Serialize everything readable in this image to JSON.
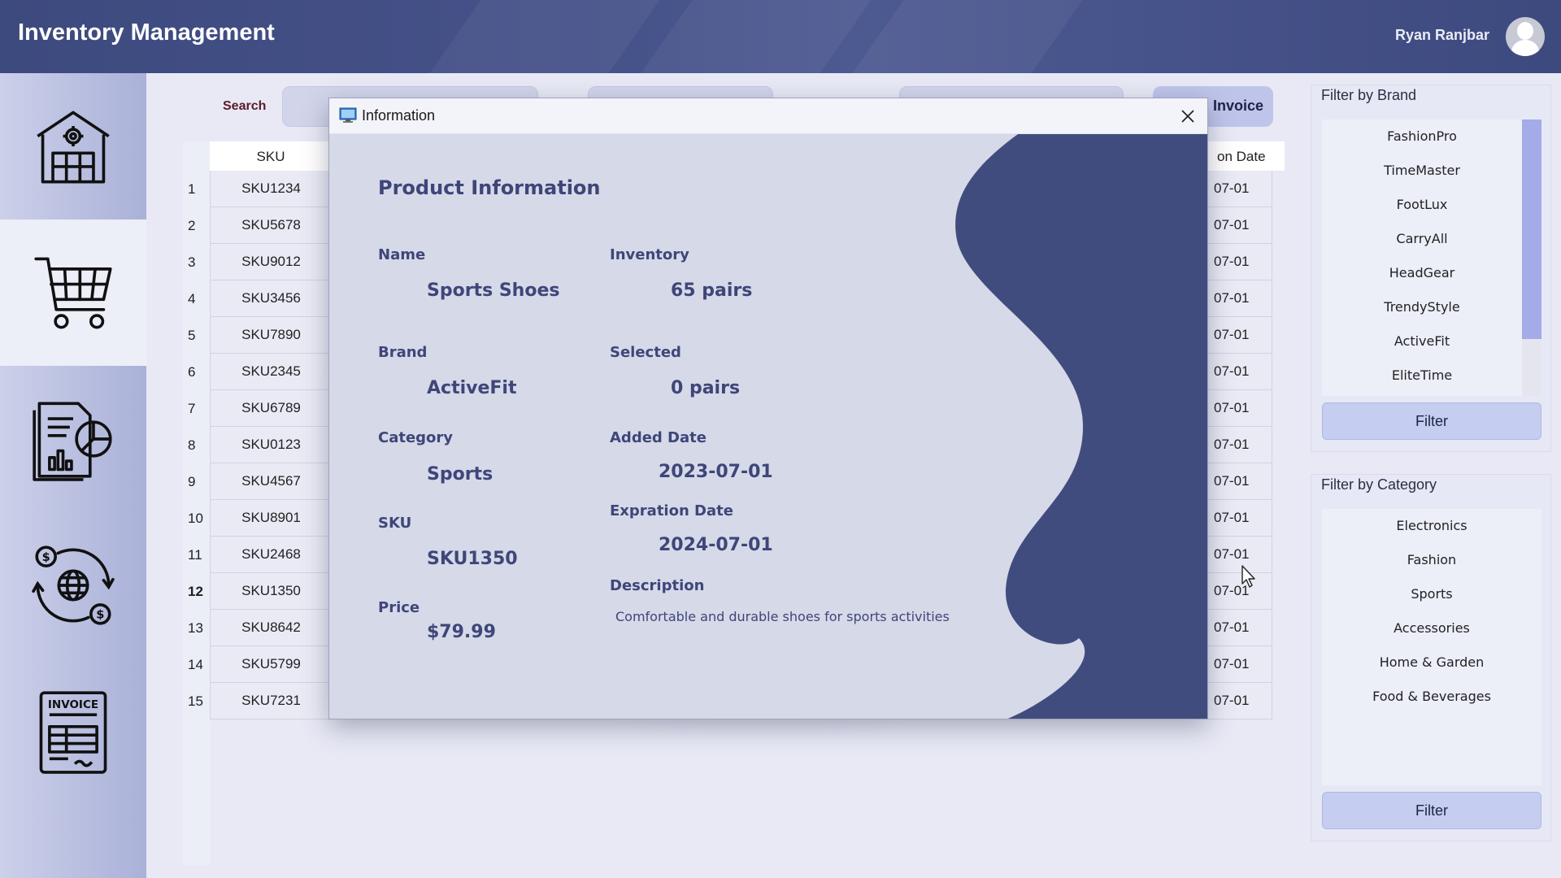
{
  "header": {
    "app_title": "Inventory Management",
    "user_name": "Ryan Ranjbar"
  },
  "sidebar": {
    "items": [
      {
        "name": "warehouse-icon",
        "active": false
      },
      {
        "name": "cart-icon",
        "active": true
      },
      {
        "name": "reports-icon",
        "active": false
      },
      {
        "name": "currency-exchange-icon",
        "active": false
      },
      {
        "name": "invoice-icon",
        "active": false
      }
    ]
  },
  "toolbar": {
    "search_label": "Search",
    "search_placeholder": "",
    "invoice_label": "Invoice"
  },
  "table": {
    "headers": {
      "sku": "SKU",
      "expiration_date": "on Date"
    },
    "rows": [
      {
        "num": "1",
        "sku": "SKU1234",
        "exp": "07-01"
      },
      {
        "num": "2",
        "sku": "SKU5678",
        "exp": "07-01"
      },
      {
        "num": "3",
        "sku": "SKU9012",
        "exp": "07-01"
      },
      {
        "num": "4",
        "sku": "SKU3456",
        "exp": "07-01"
      },
      {
        "num": "5",
        "sku": "SKU7890",
        "exp": "07-01"
      },
      {
        "num": "6",
        "sku": "SKU2345",
        "exp": "07-01"
      },
      {
        "num": "7",
        "sku": "SKU6789",
        "exp": "07-01"
      },
      {
        "num": "8",
        "sku": "SKU0123",
        "exp": "07-01"
      },
      {
        "num": "9",
        "sku": "SKU4567",
        "exp": "07-01"
      },
      {
        "num": "10",
        "sku": "SKU8901",
        "exp": "07-01"
      },
      {
        "num": "11",
        "sku": "SKU2468",
        "exp": "07-01"
      },
      {
        "num": "12",
        "sku": "SKU1350",
        "exp": "07-01"
      },
      {
        "num": "13",
        "sku": "SKU8642",
        "exp": "07-01"
      },
      {
        "num": "14",
        "sku": "SKU5799",
        "exp": "07-01"
      },
      {
        "num": "15",
        "sku": "SKU7231",
        "exp": "07-01"
      }
    ]
  },
  "filters": {
    "brand": {
      "title": "Filter by Brand",
      "items": [
        "FashionPro",
        "TimeMaster",
        "FootLux",
        "CarryAll",
        "HeadGear",
        "TrendyStyle",
        "ActiveFit",
        "EliteTime"
      ],
      "button_label": "Filter"
    },
    "category": {
      "title": "Filter by Category",
      "items": [
        "Electronics",
        "Fashion",
        "Sports",
        "Accessories",
        "Home & Garden",
        "Food & Beverages"
      ],
      "button_label": "Filter"
    }
  },
  "dialog": {
    "title": "Information",
    "heading": "Product Information",
    "fields": {
      "name_label": "Name",
      "name_value": "Sports Shoes",
      "brand_label": "Brand",
      "brand_value": "ActiveFit",
      "category_label": "Category",
      "category_value": "Sports",
      "sku_label": "SKU",
      "sku_value": "SKU1350",
      "price_label": "Price",
      "price_value": "$79.99",
      "inventory_label": "Inventory",
      "inventory_value": "65 pairs",
      "selected_label": "Selected",
      "selected_value": "0 pairs",
      "added_date_label": "Added Date",
      "added_date_value": "2023-07-01",
      "expiration_date_label": "Expration Date",
      "expiration_date_value": "2024-07-01",
      "description_label": "Description",
      "description_value": "Comfortable and durable shoes for sports activities"
    }
  },
  "colors": {
    "header_bg": "#3d4a7e",
    "accent_navy": "#404c80",
    "label_text": "#3e4679",
    "filter_button": "#c5cdf0",
    "scroll_thumb": "#a4abe9"
  }
}
